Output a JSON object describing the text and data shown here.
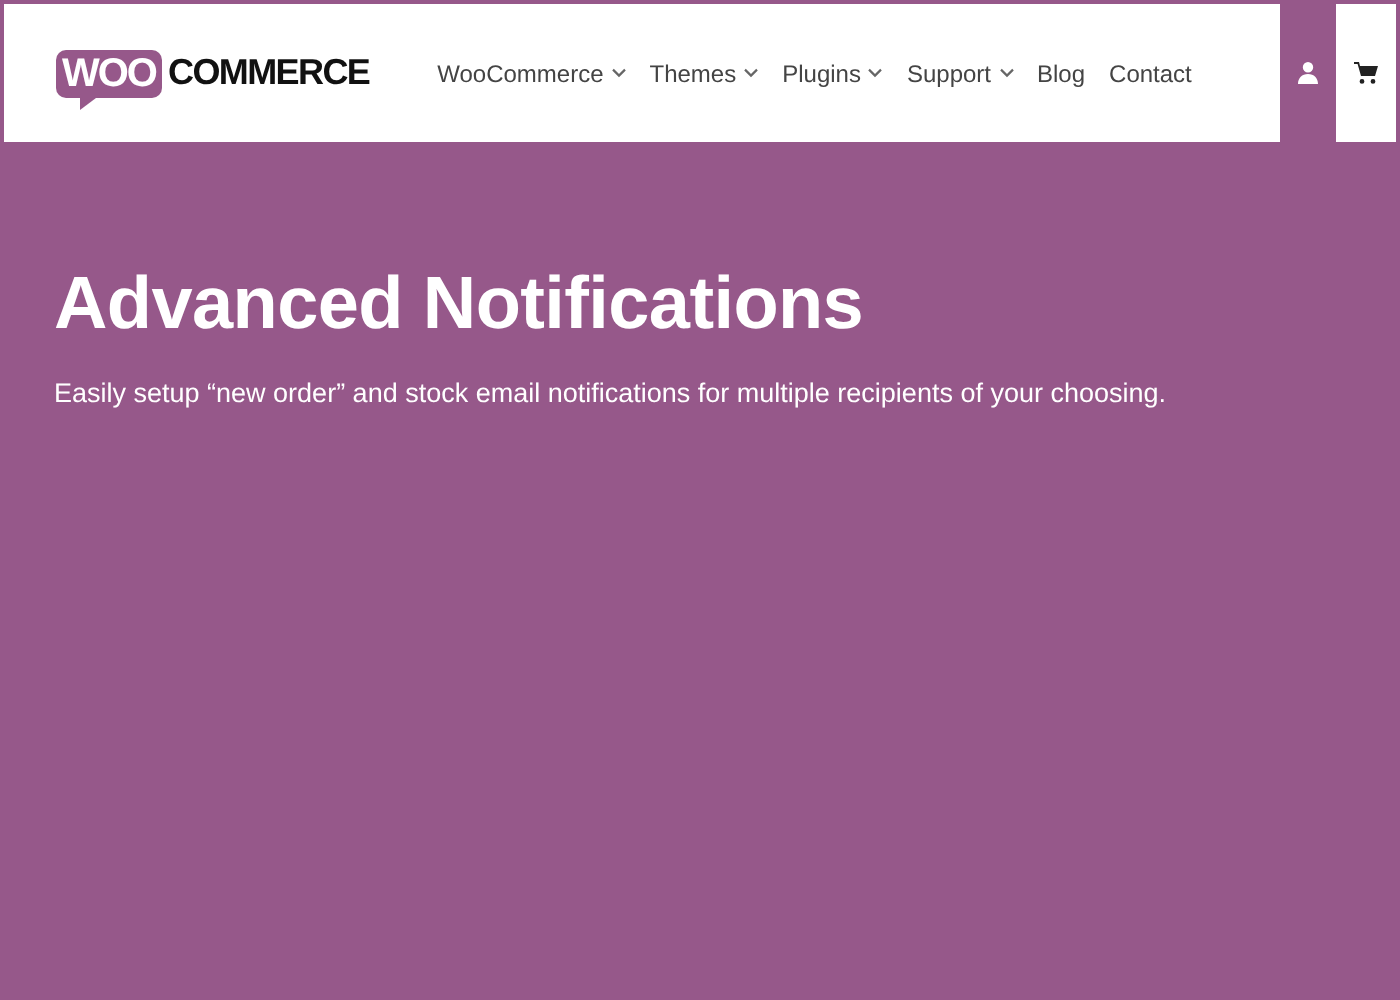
{
  "header": {
    "logo": {
      "badge": "WOO",
      "wordmark": "COMMERCE"
    },
    "nav": [
      {
        "label": "WooCommerce",
        "dropdown": true
      },
      {
        "label": "Themes",
        "dropdown": true
      },
      {
        "label": "Plugins",
        "dropdown": true
      },
      {
        "label": "Support",
        "dropdown": true
      },
      {
        "label": "Blog",
        "dropdown": false
      },
      {
        "label": "Contact",
        "dropdown": false
      }
    ],
    "account": {
      "selected": true
    }
  },
  "hero": {
    "title": "Advanced Notifications",
    "subtitle": "Easily setup “new order” and stock email notifications for multiple recipients of your choosing."
  }
}
